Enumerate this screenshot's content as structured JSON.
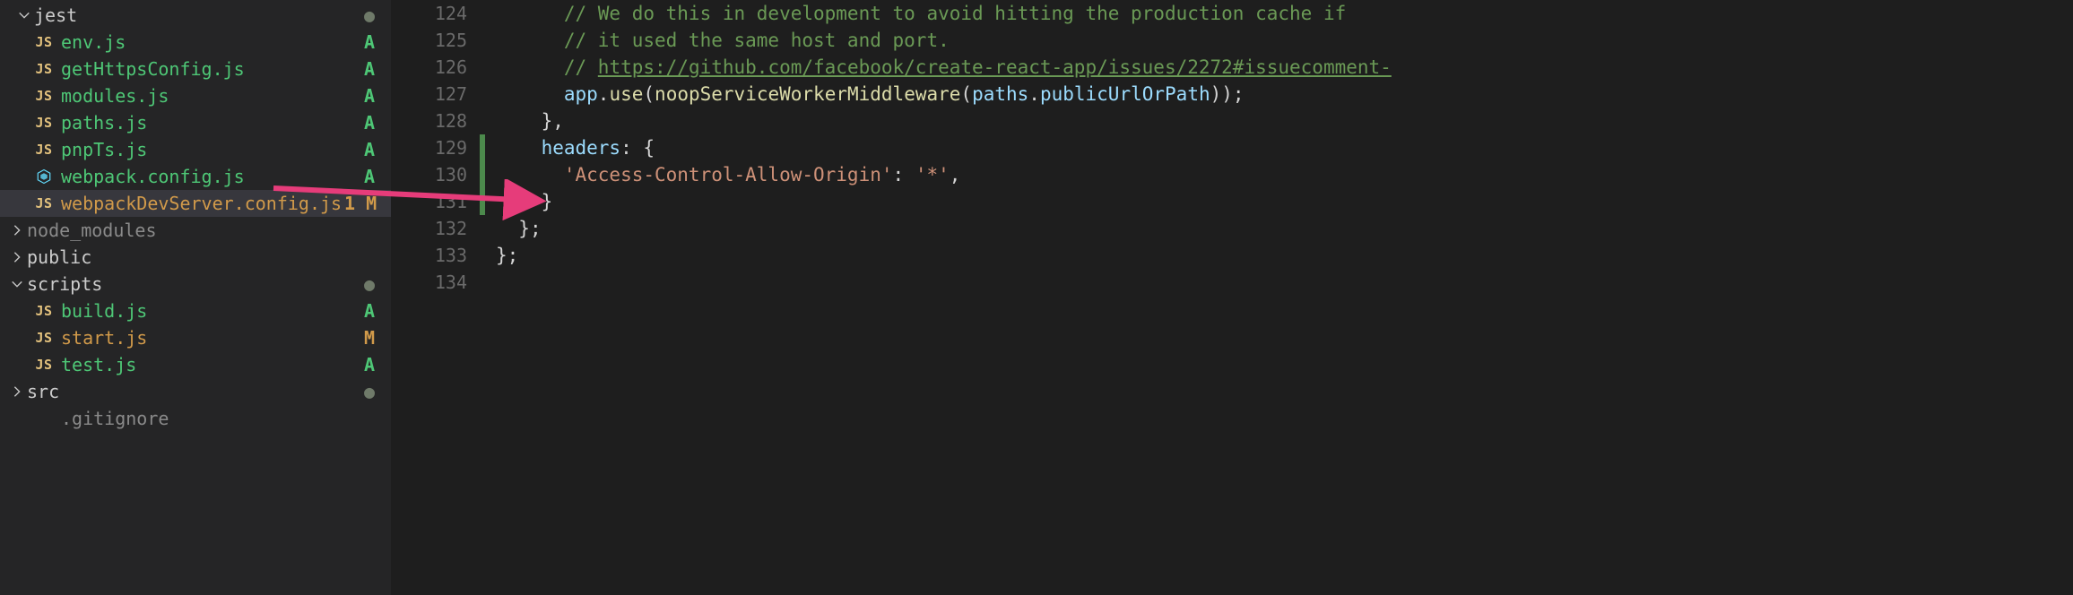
{
  "sidebar": {
    "items": [
      {
        "kind": "folder",
        "expanded": true,
        "indent": 2,
        "icon": "chevron-down",
        "name": "jest",
        "status": "dot",
        "color": "norm"
      },
      {
        "kind": "file",
        "indent": 2,
        "icon": "js",
        "name": "env.js",
        "status": "A",
        "color": "green"
      },
      {
        "kind": "file",
        "indent": 2,
        "icon": "js",
        "name": "getHttpsConfig.js",
        "status": "A",
        "color": "green"
      },
      {
        "kind": "file",
        "indent": 2,
        "icon": "js",
        "name": "modules.js",
        "status": "A",
        "color": "green"
      },
      {
        "kind": "file",
        "indent": 2,
        "icon": "js",
        "name": "paths.js",
        "status": "A",
        "color": "green"
      },
      {
        "kind": "file",
        "indent": 2,
        "icon": "js",
        "name": "pnpTs.js",
        "status": "A",
        "color": "green"
      },
      {
        "kind": "file",
        "indent": 2,
        "icon": "wp",
        "name": "webpack.config.js",
        "status": "A",
        "color": "green"
      },
      {
        "kind": "file",
        "indent": 2,
        "icon": "js",
        "name": "webpackDevServer.config.js",
        "status": "1 M",
        "color": "mod",
        "selected": true
      },
      {
        "kind": "folder",
        "expanded": false,
        "indent": 1,
        "icon": "chevron-right",
        "name": "node_modules",
        "status": "",
        "color": "dim"
      },
      {
        "kind": "folder",
        "expanded": false,
        "indent": 1,
        "icon": "chevron-right",
        "name": "public",
        "status": "",
        "color": "norm"
      },
      {
        "kind": "folder",
        "expanded": true,
        "indent": 1,
        "icon": "chevron-down",
        "name": "scripts",
        "status": "dot",
        "color": "norm"
      },
      {
        "kind": "file",
        "indent": 2,
        "icon": "js",
        "name": "build.js",
        "status": "A",
        "color": "green"
      },
      {
        "kind": "file",
        "indent": 2,
        "icon": "js",
        "name": "start.js",
        "status": "M",
        "color": "mod"
      },
      {
        "kind": "file",
        "indent": 2,
        "icon": "js",
        "name": "test.js",
        "status": "A",
        "color": "green"
      },
      {
        "kind": "folder",
        "expanded": false,
        "indent": 1,
        "icon": "chevron-right",
        "name": "src",
        "status": "dot",
        "color": "norm"
      },
      {
        "kind": "file",
        "indent": 2,
        "icon": "none",
        "name": ".gitignore",
        "status": "",
        "color": "dim"
      }
    ]
  },
  "editor": {
    "lines": [
      {
        "n": 124,
        "mod": false,
        "tokens": [
          {
            "cls": "plain",
            "pad": "      "
          },
          {
            "cls": "comment",
            "t": "// We do this in development to avoid hitting the production cache if"
          }
        ]
      },
      {
        "n": 125,
        "mod": false,
        "tokens": [
          {
            "cls": "plain",
            "pad": "      "
          },
          {
            "cls": "comment",
            "t": "// it used the same host and port."
          }
        ]
      },
      {
        "n": 126,
        "mod": false,
        "tokens": [
          {
            "cls": "plain",
            "pad": "      "
          },
          {
            "cls": "comment",
            "t": "// "
          },
          {
            "cls": "comment-link",
            "t": "https://github.com/facebook/create-react-app/issues/2272#issuecomment-"
          }
        ]
      },
      {
        "n": 127,
        "mod": false,
        "tokens": [
          {
            "cls": "plain",
            "pad": "      "
          },
          {
            "cls": "var",
            "t": "app"
          },
          {
            "cls": "punct",
            "t": "."
          },
          {
            "cls": "func",
            "t": "use"
          },
          {
            "cls": "punct",
            "t": "("
          },
          {
            "cls": "func",
            "t": "noopServiceWorkerMiddleware"
          },
          {
            "cls": "punct",
            "t": "("
          },
          {
            "cls": "var",
            "t": "paths"
          },
          {
            "cls": "punct",
            "t": "."
          },
          {
            "cls": "var",
            "t": "publicUrlOrPath"
          },
          {
            "cls": "punct",
            "t": "));"
          }
        ]
      },
      {
        "n": 128,
        "mod": false,
        "tokens": [
          {
            "cls": "plain",
            "pad": "    "
          },
          {
            "cls": "punct",
            "t": "},"
          }
        ]
      },
      {
        "n": 129,
        "mod": true,
        "tokens": [
          {
            "cls": "plain",
            "pad": "    "
          },
          {
            "cls": "key",
            "t": "headers"
          },
          {
            "cls": "punct",
            "t": ":"
          },
          {
            "cls": "plain",
            "t": " "
          },
          {
            "cls": "punct",
            "t": "{"
          }
        ]
      },
      {
        "n": 130,
        "mod": true,
        "tokens": [
          {
            "cls": "plain",
            "pad": "      "
          },
          {
            "cls": "str",
            "t": "'Access-Control-Allow-Origin'"
          },
          {
            "cls": "punct",
            "t": ":"
          },
          {
            "cls": "plain",
            "t": " "
          },
          {
            "cls": "str",
            "t": "'*'"
          },
          {
            "cls": "punct",
            "t": ","
          }
        ]
      },
      {
        "n": 131,
        "mod": true,
        "tokens": [
          {
            "cls": "plain",
            "pad": "    "
          },
          {
            "cls": "punct",
            "t": "}"
          }
        ]
      },
      {
        "n": 132,
        "mod": false,
        "tokens": [
          {
            "cls": "plain",
            "pad": "  "
          },
          {
            "cls": "punct",
            "t": "};"
          }
        ]
      },
      {
        "n": 133,
        "mod": false,
        "tokens": [
          {
            "cls": "punct",
            "t": "};"
          }
        ]
      },
      {
        "n": 134,
        "mod": false,
        "tokens": []
      }
    ]
  },
  "annotation": {
    "arrow_color": "#e63c7a"
  }
}
